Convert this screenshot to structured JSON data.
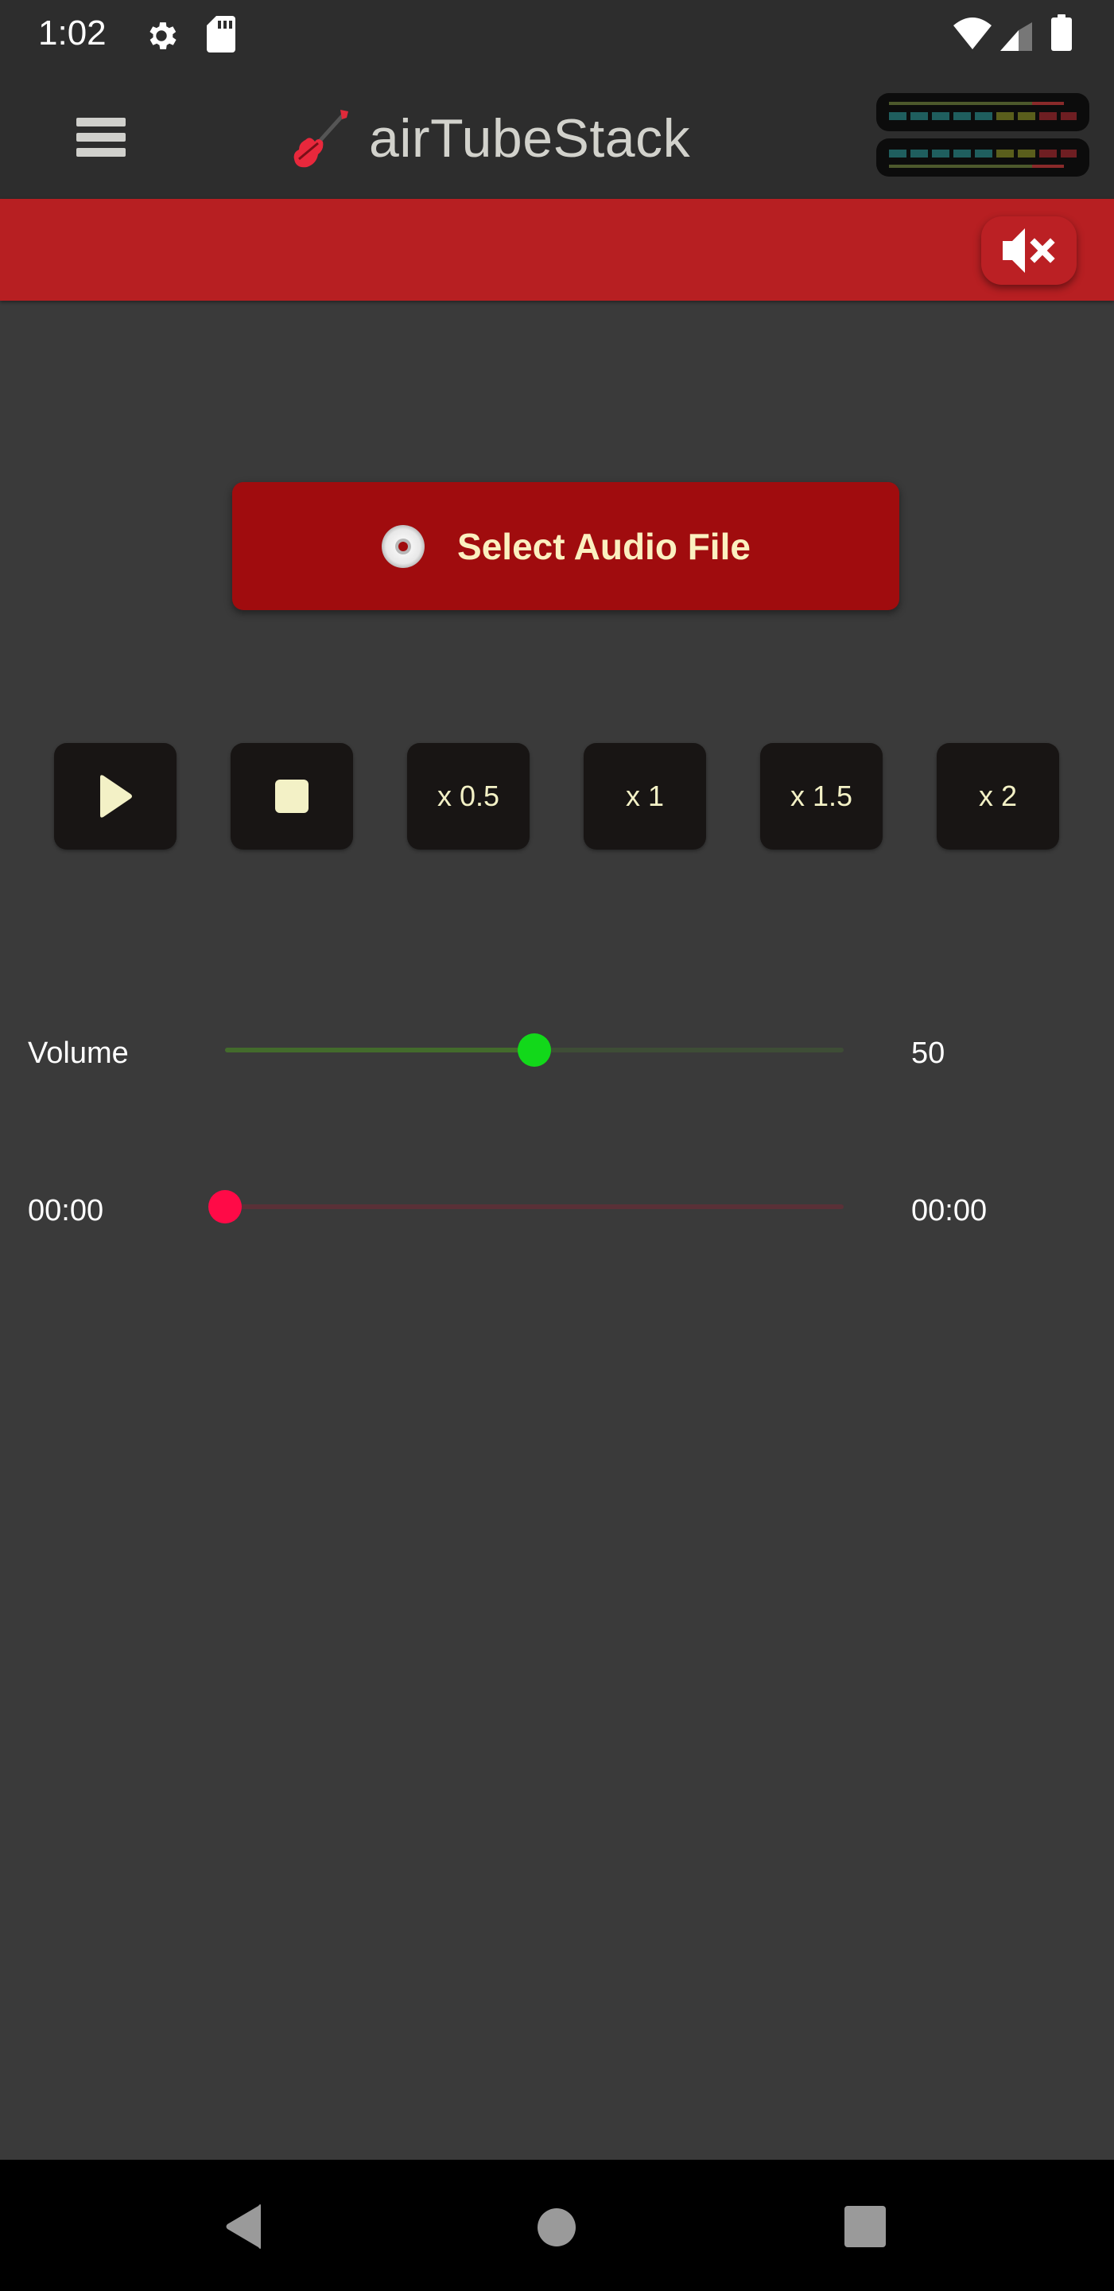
{
  "status_bar": {
    "time": "1:02",
    "left_icons": [
      "settings-icon",
      "sd-card-icon"
    ],
    "right_icons": [
      "wifi-icon",
      "cell-signal-icon",
      "battery-icon"
    ]
  },
  "toolbar": {
    "menu_icon": "hamburger-menu-icon",
    "app_icon": "guitar-icon",
    "title": "airTubeStack",
    "meter_icon": "vu-meter-icon"
  },
  "banner": {
    "mute_button_icon": "speaker-muted-icon"
  },
  "main": {
    "select_button": {
      "icon": "cd-disc-icon",
      "label": "Select Audio File"
    },
    "controls": [
      {
        "name": "play",
        "icon": "play-icon",
        "label": ""
      },
      {
        "name": "stop",
        "icon": "stop-icon",
        "label": ""
      },
      {
        "name": "speed-0-5",
        "label": "x 0.5"
      },
      {
        "name": "speed-1",
        "label": "x 1"
      },
      {
        "name": "speed-1-5",
        "label": "x 1.5"
      },
      {
        "name": "speed-2",
        "label": "x 2"
      }
    ],
    "volume": {
      "label": "Volume",
      "value": 50,
      "value_text": "50",
      "max": 100,
      "color": "#12d81a"
    },
    "progress": {
      "elapsed": "00:00",
      "total": "00:00",
      "fraction": 0,
      "color": "#ff0a47"
    }
  },
  "colors": {
    "banner": "#b71f22",
    "select_button": "#a00c0e",
    "select_text": "#fbf0c0",
    "control_bg": "#181514",
    "control_text": "#f3f1c6",
    "background": "#3a3a3a",
    "toolbar": "#2d2d2d"
  },
  "nav_bar": {
    "buttons": [
      "back-icon",
      "home-icon",
      "recents-icon"
    ]
  }
}
